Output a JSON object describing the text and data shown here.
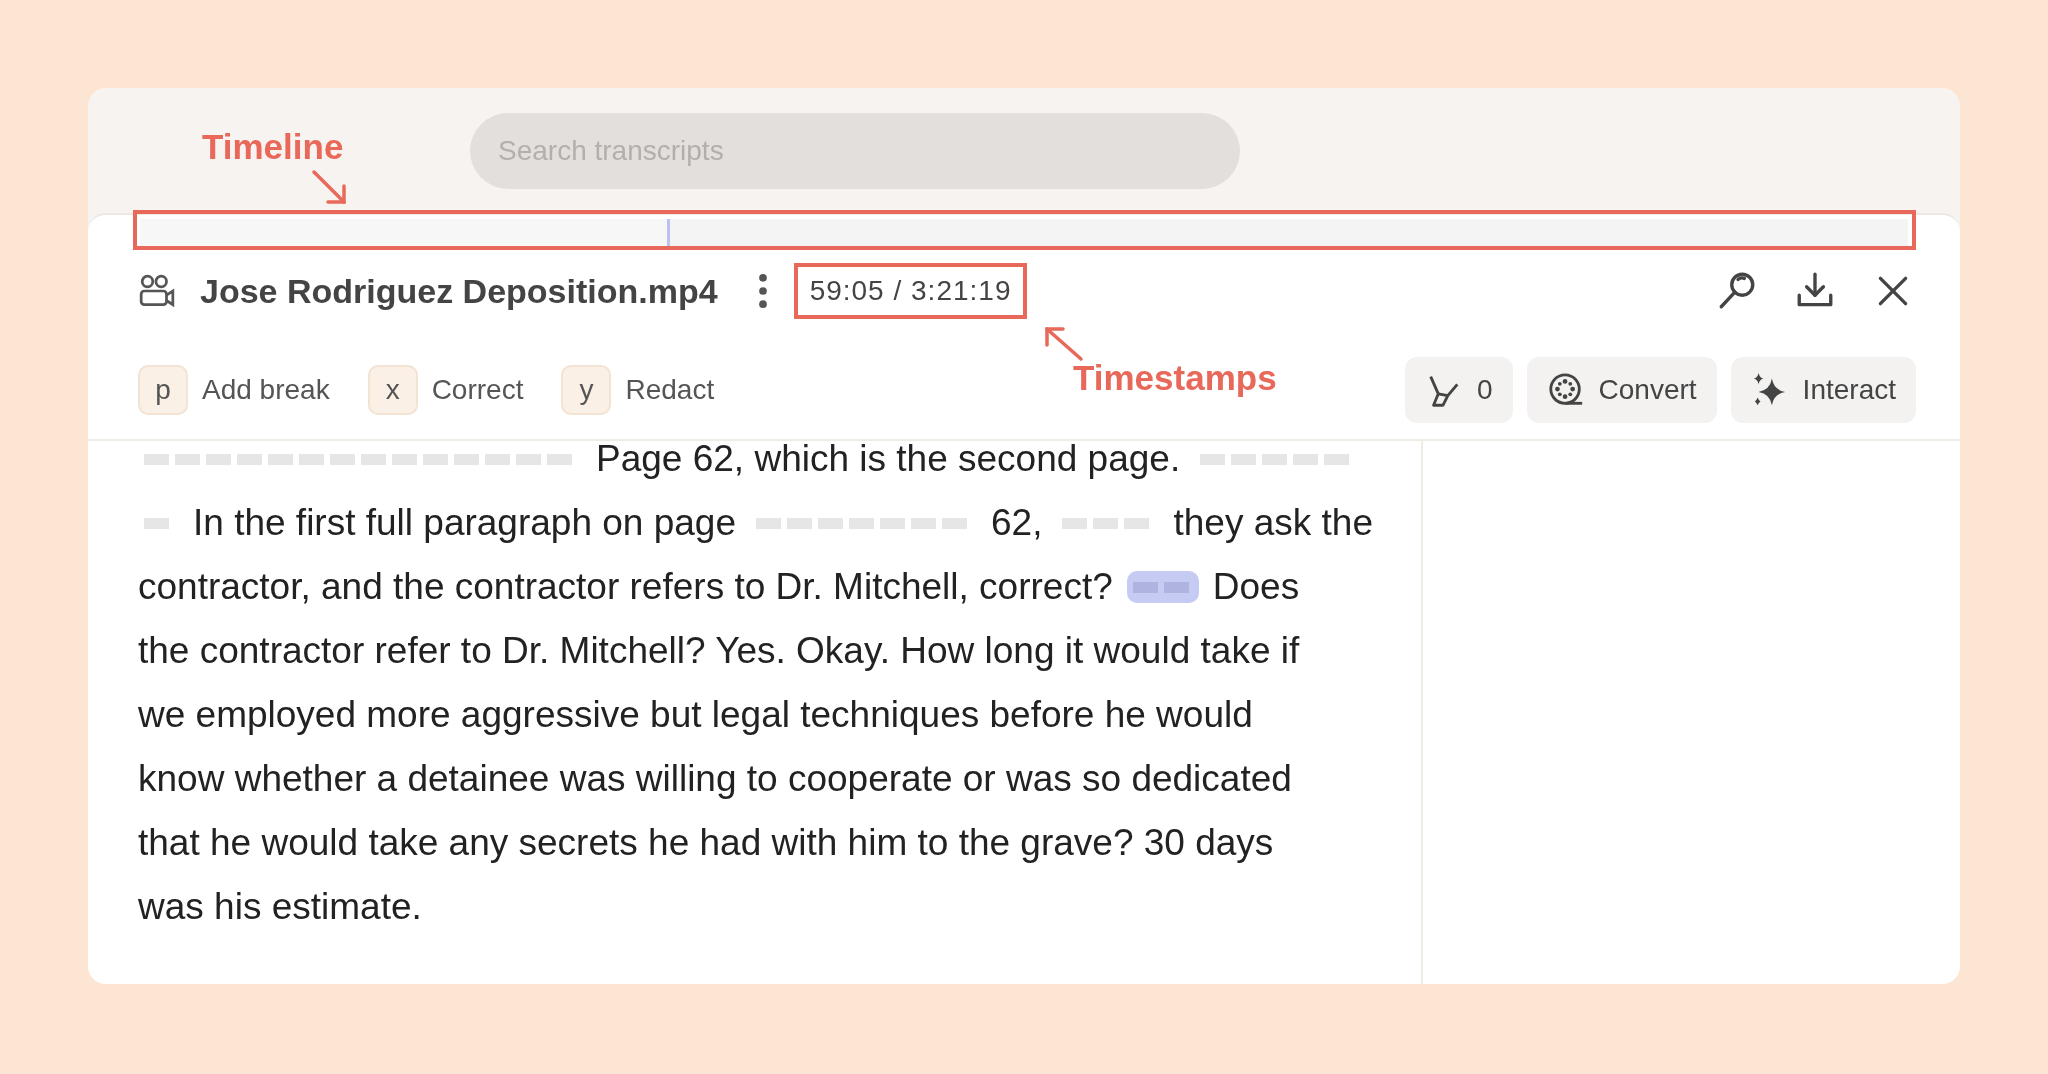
{
  "search": {
    "placeholder": "Search transcripts"
  },
  "timeline": {
    "level": 0.3
  },
  "file": {
    "title": "Jose Rodriguez Deposition.mp4",
    "timestamp": "59:05 / 3:21:19"
  },
  "shortcuts": [
    {
      "key": "p",
      "label": "Add break"
    },
    {
      "key": "x",
      "label": "Correct"
    },
    {
      "key": "y",
      "label": "Redact"
    }
  ],
  "actions": [
    {
      "kind": "highlighter",
      "label": "0"
    },
    {
      "kind": "convert",
      "label": "Convert"
    },
    {
      "kind": "interact",
      "label": "Interact"
    }
  ],
  "transcript": [
    {
      "segments": [
        {
          "kind": "gap",
          "highlighted": false
        },
        {
          "kind": "text",
          "text": "Page 62, which is the second page."
        },
        {
          "kind": "gap",
          "highlighted": false
        }
      ]
    },
    {
      "segments": [
        {
          "kind": "gap",
          "highlighted": false
        },
        {
          "kind": "text",
          "text": "In the first full paragraph on page"
        },
        {
          "kind": "gap",
          "highlighted": false
        },
        {
          "kind": "text",
          "text": "62,"
        },
        {
          "kind": "gap",
          "highlighted": false
        },
        {
          "kind": "text",
          "text": "they ask the"
        }
      ]
    },
    {
      "segments": [
        {
          "kind": "text",
          "text": "contractor, and the contractor refers to Dr. Mitchell, correct?"
        },
        {
          "kind": "gap",
          "highlighted": true
        },
        {
          "kind": "text",
          "text": "Does"
        }
      ]
    },
    {
      "segments": [
        {
          "kind": "text",
          "text": "the contractor refer to Dr. Mitchell? Yes. Okay. How long it would take if"
        }
      ]
    },
    {
      "segments": [
        {
          "kind": "text",
          "text": "we employed more aggressive but legal techniques before he would"
        }
      ]
    },
    {
      "segments": [
        {
          "kind": "text",
          "text": "know whether a detainee was willing to cooperate or was so dedicated"
        }
      ]
    },
    {
      "segments": [
        {
          "kind": "text",
          "text": "that he would take any secrets he had with him to the grave? 30 days"
        }
      ]
    },
    {
      "segments": [
        {
          "kind": "text",
          "text": "was his estimate."
        }
      ]
    }
  ],
  "annotations": [
    {
      "kind": "timeline",
      "label": "Timeline"
    },
    {
      "kind": "timestamps",
      "label": "Timestamps"
    }
  ]
}
